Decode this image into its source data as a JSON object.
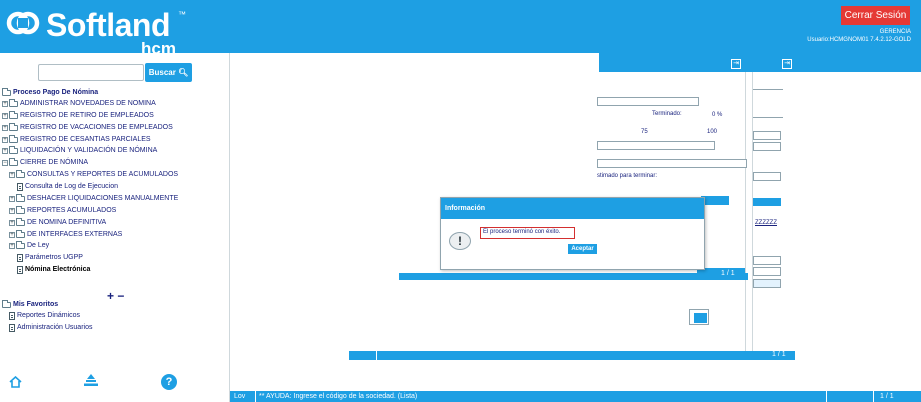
{
  "header": {
    "logo_text": "Softland",
    "logo_tm": "™",
    "logo_sub": "hcm",
    "logout_label": "Cerrar Sesión",
    "role": "GERENCIA",
    "user": "Usuario:HCMGNOM01 7.4.2.12-GOLD"
  },
  "search": {
    "button_label": "Buscar",
    "value": ""
  },
  "tree": {
    "root": "Proceso Pago De Nómina",
    "items": [
      "ADMINISTRAR NOVEDADES DE NOMINA",
      "REGISTRO DE RETIRO DE EMPLEADOS",
      "REGISTRO DE VACACIONES DE EMPLEADOS",
      "REGISTRO DE CESANTIAS PARCIALES",
      "LIQUIDACIÓN Y VALIDACIÓN DE NÓMINA",
      "CIERRE DE NÓMINA",
      "CONSULTAS Y REPORTES DE ACUMULADOS",
      "Consulta de Log de Ejecucion",
      "DESHACER LIQUIDACIONES MANUALMENTE",
      "REPORTES ACUMULADOS",
      "DE NOMINA DEFINITIVA",
      "DE INTERFACES EXTERNAS",
      "De Ley",
      "Parámetros UGPP",
      "Nómina Electrónica"
    ],
    "plus_minus": "+ −",
    "favorites_root": "Mis Favoritos",
    "favorites": [
      "Reportes Dinámicos",
      "Administración Usuarios"
    ]
  },
  "sidebar_icons": [
    "home-icon",
    "layers-icon",
    "help-icon"
  ],
  "help_glyph": "?",
  "main": {
    "terminado_label": "Terminado:",
    "terminado_value": "0 %",
    "progress_mid": "75",
    "progress_max": "100",
    "estimado_label": "stimado para terminar:",
    "code_fragment": "ZZZZZZ",
    "page_a": "1 / 1",
    "page_b": "1 / 1"
  },
  "dialog": {
    "title": "Información",
    "message": "El proceso terminó con éxito.",
    "accept_label": "Aceptar",
    "icon_glyph": "!"
  },
  "statusbar": {
    "lov": "Lov",
    "help": "** AYUDA: Ingrese el código de la sociedad. (Lista)",
    "page": "1 / 1"
  },
  "colors": {
    "primary": "#1e9fe3",
    "danger": "#e53935",
    "text": "#1a237e"
  }
}
